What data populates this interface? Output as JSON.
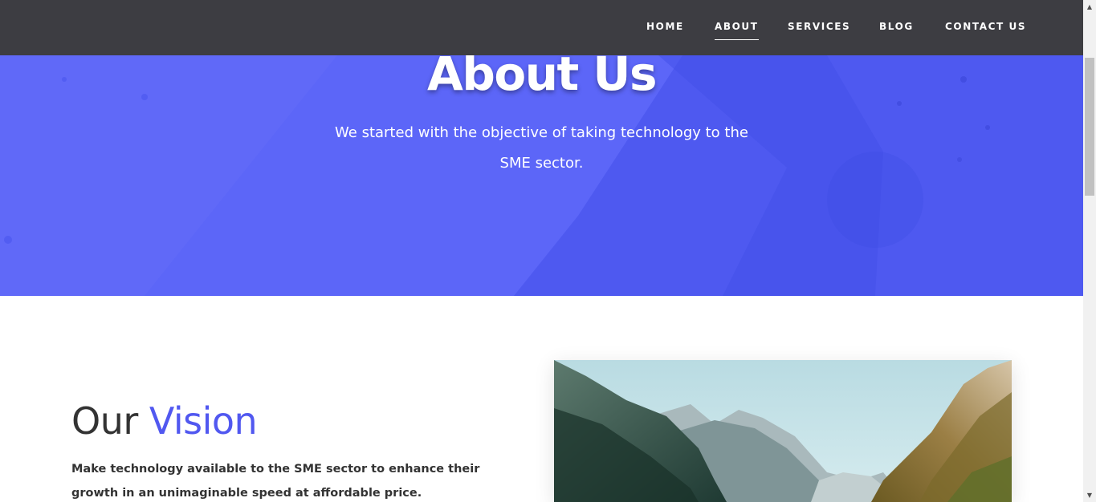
{
  "nav": {
    "items": [
      {
        "label": "HOME"
      },
      {
        "label": "ABOUT",
        "active": true
      },
      {
        "label": "SERVICES"
      },
      {
        "label": "BLOG"
      },
      {
        "label": "CONTACT US"
      }
    ]
  },
  "hero": {
    "title": "About Us",
    "subtitle": "We started with the objective of taking technology to the SME sector.",
    "background_color": "#5c66f8"
  },
  "vision": {
    "title_plain": "Our",
    "title_accent": "Vision",
    "accent_color": "#5158f0",
    "text": "Make technology available to the SME sector to enhance their growth in an unimaginable speed at affordable price.",
    "image_description": "mountain-valley-photo"
  },
  "scrollbar": {
    "up_icon": "scroll-up-arrow-icon",
    "down_icon": "scroll-down-arrow-icon"
  }
}
